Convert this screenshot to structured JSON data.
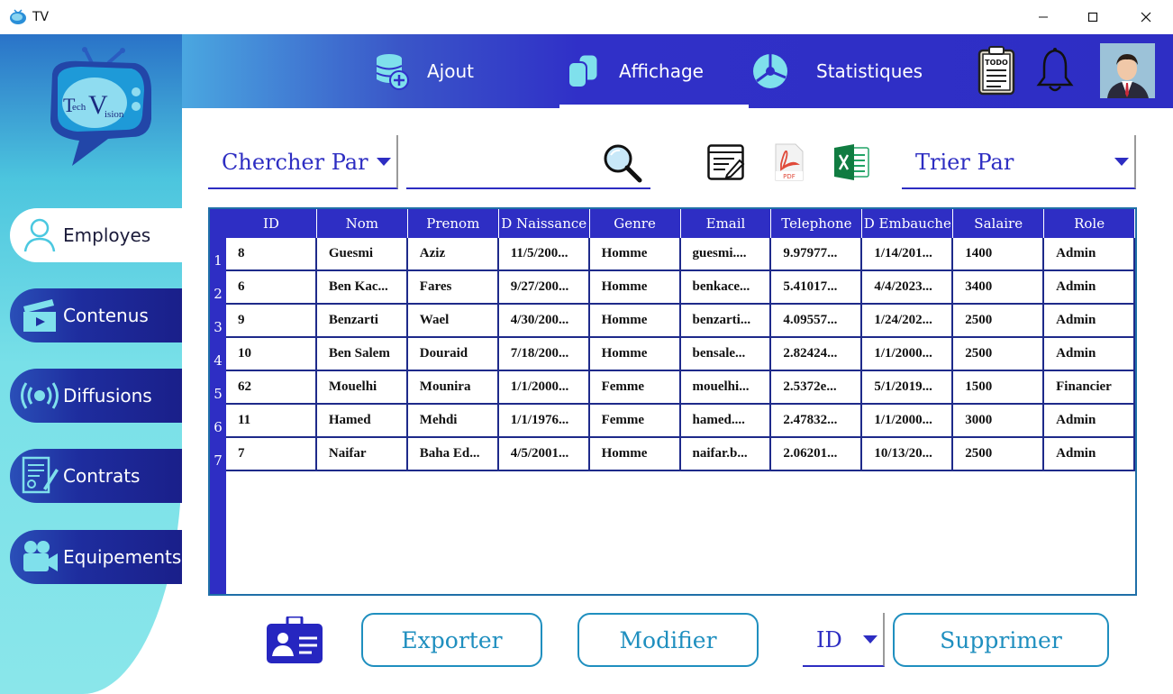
{
  "window": {
    "title": "TV"
  },
  "logo": {
    "text": "TechVision"
  },
  "header": {
    "tabs": [
      {
        "label": "Ajout",
        "icon": "database-add-icon"
      },
      {
        "label": "Affichage",
        "icon": "display-icon",
        "active": true
      },
      {
        "label": "Statistiques",
        "icon": "pie-chart-icon"
      }
    ],
    "todo_label": "TODO"
  },
  "sidebar": {
    "items": [
      {
        "label": "Employes",
        "icon": "user-icon",
        "active": true
      },
      {
        "label": "Contenus",
        "icon": "clapperboard-icon"
      },
      {
        "label": "Diffusions",
        "icon": "broadcast-icon"
      },
      {
        "label": "Contrats",
        "icon": "contract-icon"
      },
      {
        "label": "Equipements",
        "icon": "camera-icon"
      }
    ]
  },
  "search": {
    "by_label": "Chercher Par",
    "placeholder": "",
    "value": ""
  },
  "sort": {
    "label": "Trier Par"
  },
  "tools": {
    "pdf_label": "PDF"
  },
  "table": {
    "columns": [
      "ID",
      "Nom",
      "Prenom",
      "D Naissance",
      "Genre",
      "Email",
      "Telephone",
      "D Embauche",
      "Salaire",
      "Role"
    ],
    "rows": [
      {
        "n": "1",
        "cells": [
          "8",
          "Guesmi",
          "Aziz",
          "11/5/200...",
          "Homme",
          "guesmi....",
          "9.97977...",
          "1/14/201...",
          "1400",
          "Admin"
        ]
      },
      {
        "n": "2",
        "cells": [
          "6",
          "Ben Kac...",
          "Fares",
          "9/27/200...",
          "Homme",
          "benkace...",
          "5.41017...",
          "4/4/2023...",
          "3400",
          "Admin"
        ]
      },
      {
        "n": "3",
        "cells": [
          "9",
          "Benzarti",
          "Wael",
          "4/30/200...",
          "Homme",
          "benzarti...",
          "4.09557...",
          "1/24/202...",
          "2500",
          "Admin"
        ]
      },
      {
        "n": "4",
        "cells": [
          "10",
          "Ben Salem",
          "Douraid",
          "7/18/200...",
          "Homme",
          "bensale...",
          "2.82424...",
          "1/1/2000...",
          "2500",
          "Admin"
        ]
      },
      {
        "n": "5",
        "cells": [
          "62",
          "Mouelhi",
          "Mounira",
          "1/1/2000...",
          "Femme",
          "mouelhi...",
          "2.5372e...",
          "5/1/2019...",
          "1500",
          "Financier"
        ]
      },
      {
        "n": "6",
        "cells": [
          "11",
          "Hamed",
          "Mehdi",
          "1/1/1976...",
          "Femme",
          "hamed....",
          "2.47832...",
          "1/1/2000...",
          "3000",
          "Admin"
        ]
      },
      {
        "n": "7",
        "cells": [
          "7",
          "Naifar",
          "Baha Ed...",
          "4/5/2001...",
          "Homme",
          "naifar.b...",
          "2.06201...",
          "10/13/20...",
          "2500",
          "Admin"
        ]
      }
    ]
  },
  "actions": {
    "export_label": "Exporter",
    "modify_label": "Modifier",
    "id_select": "ID",
    "delete_label": "Supprimer"
  },
  "colors": {
    "primary": "#2e2ec4",
    "accent": "#1f8fbf",
    "border": "#1f6fa8"
  }
}
